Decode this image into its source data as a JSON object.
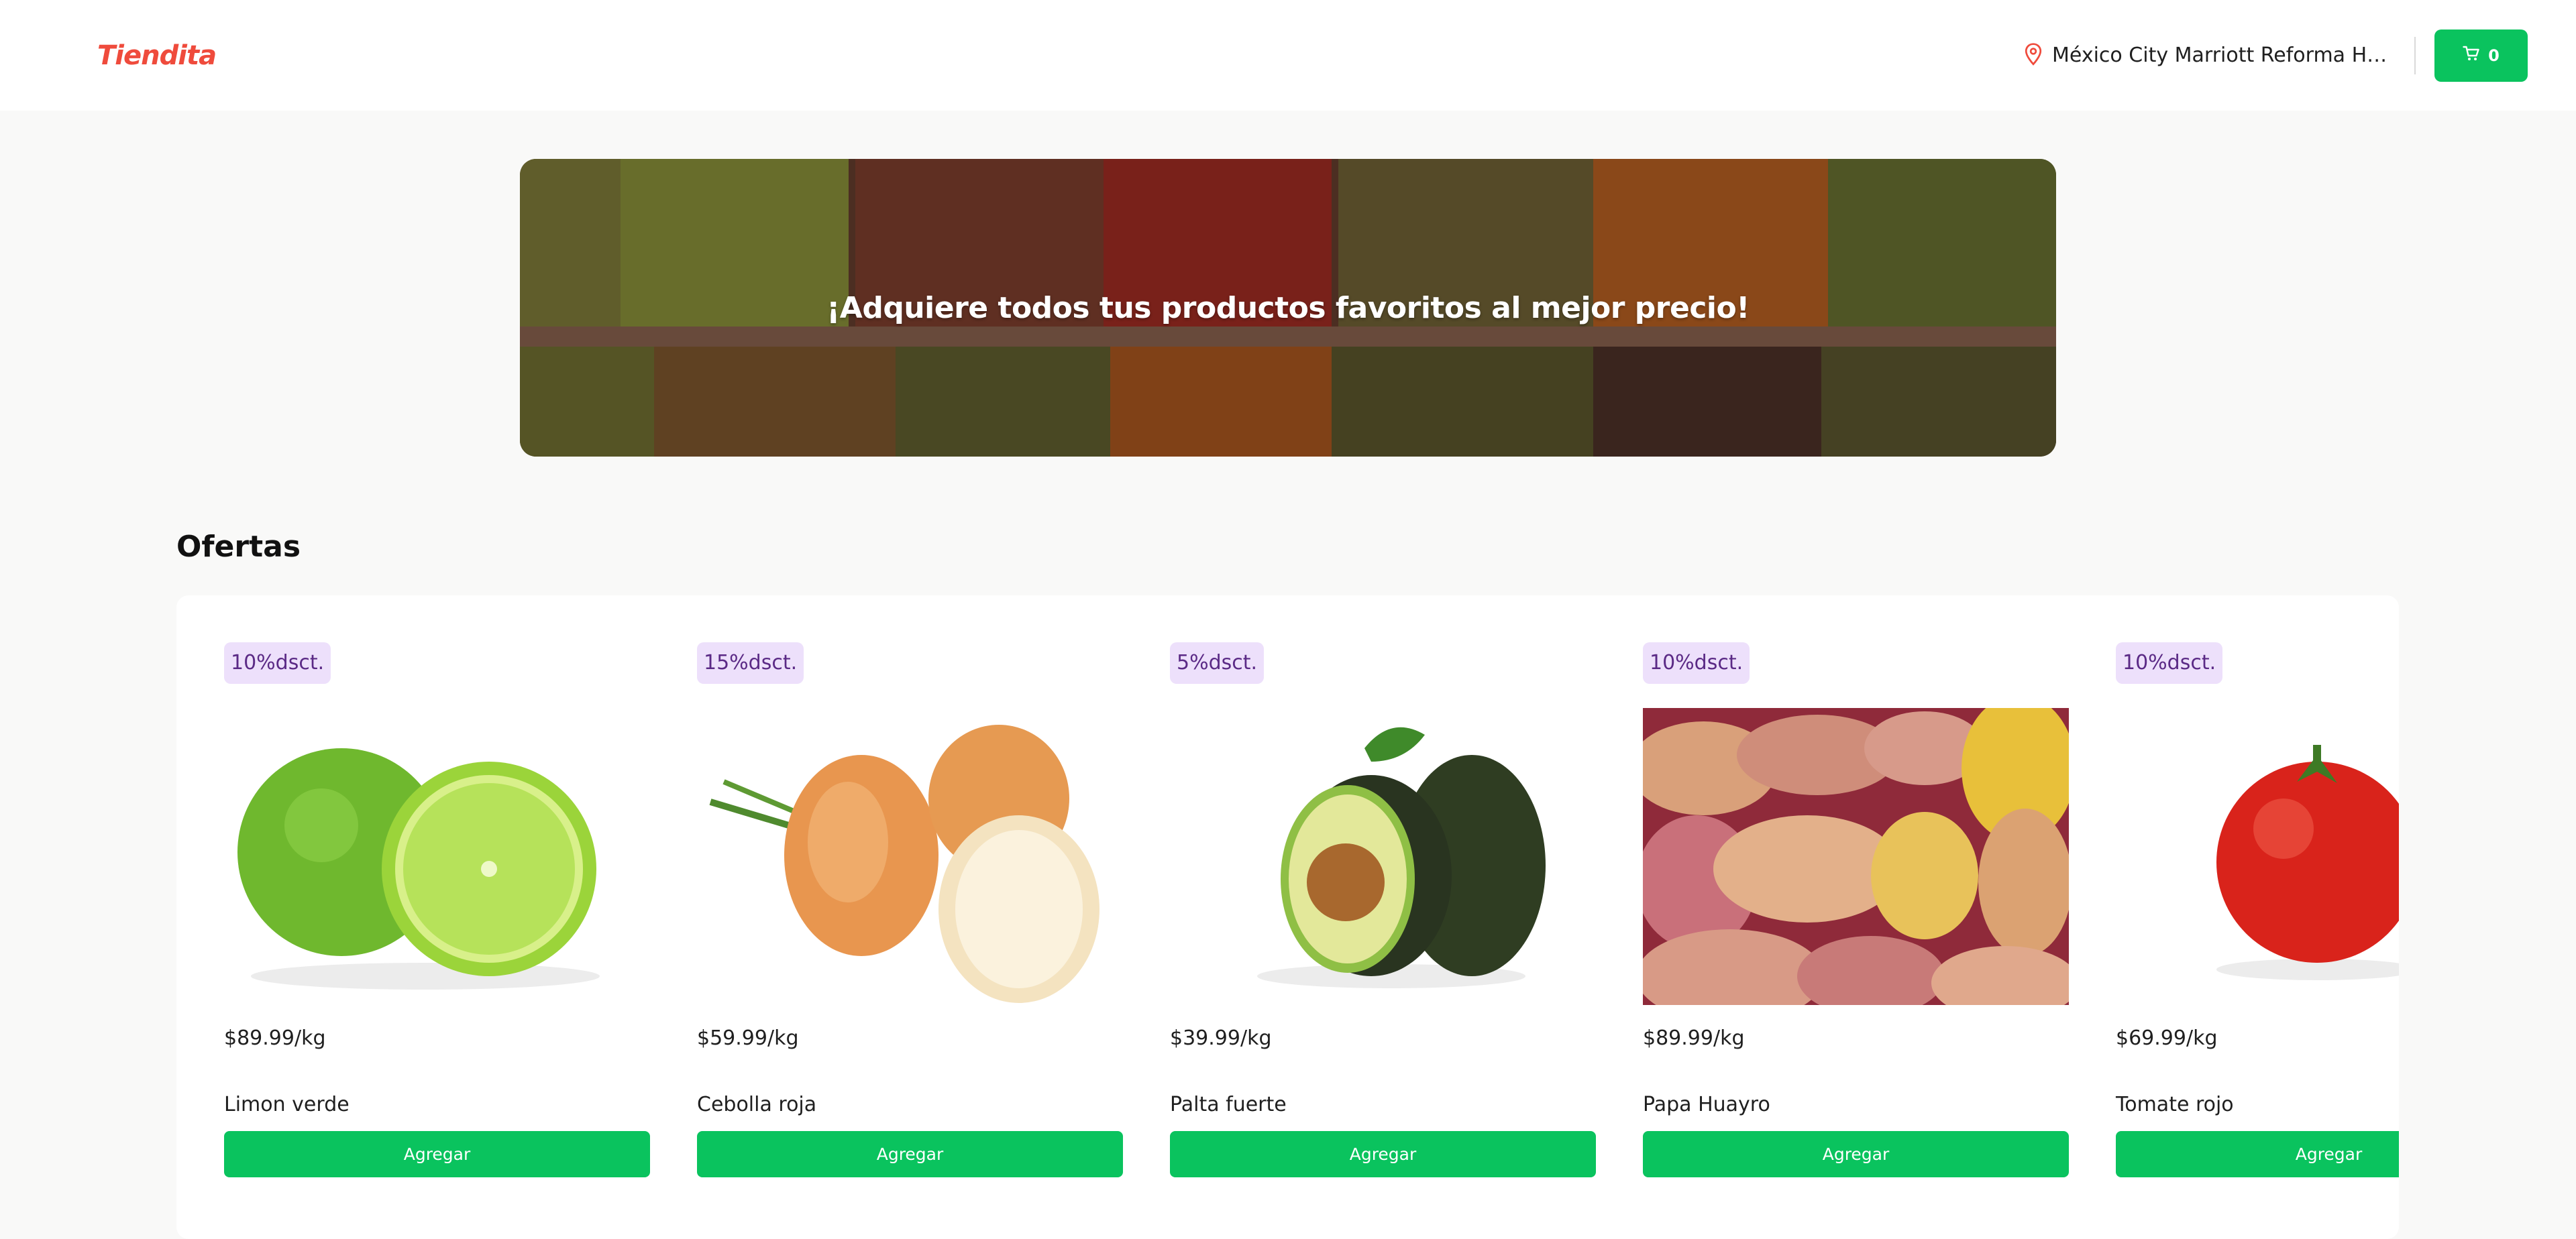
{
  "header": {
    "logo": "Tiendita",
    "location": "México City Marriott Reforma Hotel...",
    "cart_count": "0"
  },
  "banner": {
    "title": "¡Adquiere todos tus productos favoritos al mejor precio!"
  },
  "offers": {
    "title": "Ofertas",
    "products": [
      {
        "discount": "10%dsct.",
        "price": "$89.99/kg",
        "name": "Limon verde",
        "button": "Agregar"
      },
      {
        "discount": "15%dsct.",
        "price": "$59.99/kg",
        "name": "Cebolla roja",
        "button": "Agregar"
      },
      {
        "discount": "5%dsct.",
        "price": "$39.99/kg",
        "name": "Palta fuerte",
        "button": "Agregar"
      },
      {
        "discount": "10%dsct.",
        "price": "$89.99/kg",
        "name": "Papa Huayro",
        "button": "Agregar"
      },
      {
        "discount": "10%dsct.",
        "price": "$69.99/kg",
        "name": "Tomate rojo",
        "button": "Agregar"
      }
    ]
  },
  "colors": {
    "brand": "#ef4b3c",
    "accent_green": "#0ac35e",
    "badge_bg": "#ede0fb",
    "badge_text": "#5b2a86"
  },
  "icons": {
    "location": "location-pin-icon",
    "cart": "cart-icon"
  }
}
